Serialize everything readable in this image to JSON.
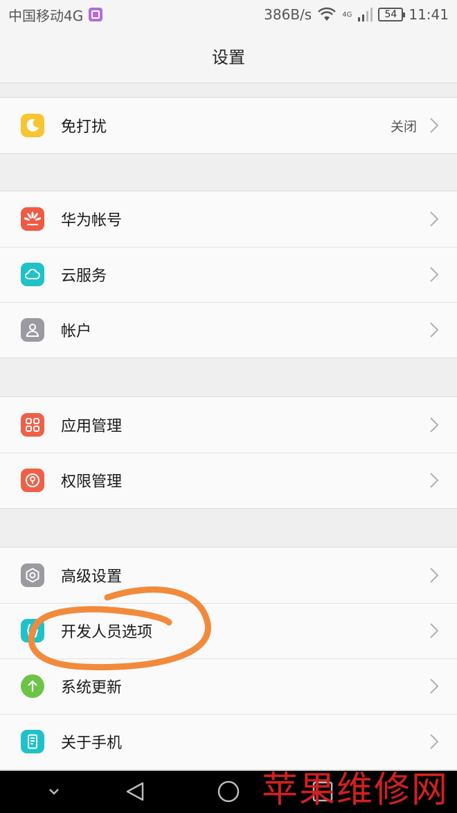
{
  "status_bar": {
    "carrier": "中国移动4G",
    "speed": "386B/s",
    "signal_type": "4G",
    "battery": "54",
    "time": "11:41"
  },
  "title_bar": {
    "title": "设置"
  },
  "groups": [
    [
      {
        "label": "免打扰",
        "value": "关闭",
        "icon": "moon-icon",
        "color": "#f7c531"
      }
    ],
    [
      {
        "label": "华为帐号",
        "icon": "huawei-logo-icon",
        "color": "#ef5a45"
      },
      {
        "label": "云服务",
        "icon": "cloud-icon",
        "color": "#1fc2c8"
      },
      {
        "label": "帐户",
        "icon": "user-icon",
        "color": "#9a9aa0"
      }
    ],
    [
      {
        "label": "应用管理",
        "icon": "apps-grid-icon",
        "color": "#f06048"
      },
      {
        "label": "权限管理",
        "icon": "key-lock-icon",
        "color": "#f06048"
      }
    ],
    [
      {
        "label": "高级设置",
        "icon": "gear-icon",
        "color": "#9a9aa0"
      },
      {
        "label": "开发人员选项",
        "icon": "braces-icon",
        "color": "#1fc2c8"
      },
      {
        "label": "系统更新",
        "icon": "arrow-up-icon",
        "color": "#6cc447"
      },
      {
        "label": "关于手机",
        "icon": "phone-icon",
        "color": "#1fc2c8"
      }
    ]
  ],
  "watermark": "苹果维修网",
  "nav_bar": [
    "chevron-down-icon",
    "back-triangle-icon",
    "home-circle-icon",
    "recents-square-icon"
  ],
  "annotation_color": "#f28a3c"
}
